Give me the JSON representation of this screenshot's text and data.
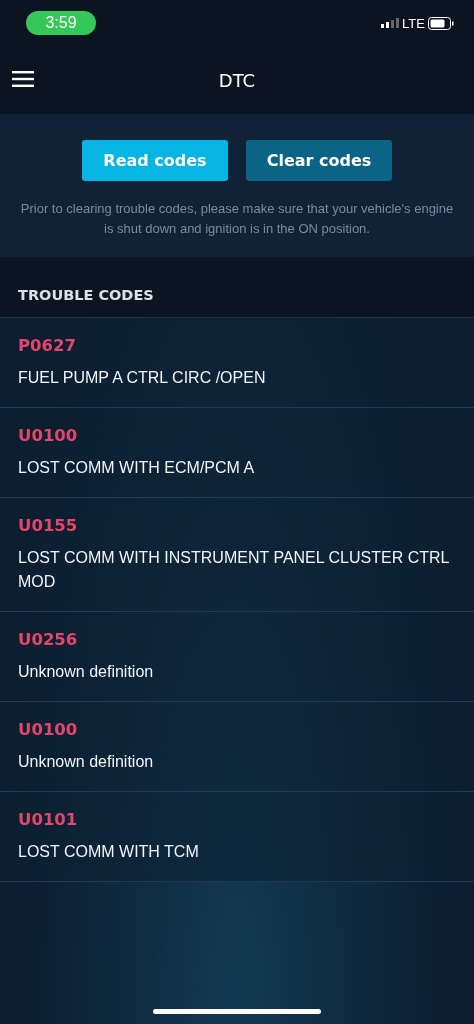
{
  "status_bar": {
    "time": "3:59",
    "network": "LTE"
  },
  "header": {
    "title": "DTC"
  },
  "actions": {
    "buttons": [
      {
        "label": "Read codes",
        "kind": "primary"
      },
      {
        "label": "Clear codes",
        "kind": "secondary"
      }
    ],
    "note": "Prior to clearing trouble codes, please make sure that your vehicle's engine is shut down and ignition is in the ON position."
  },
  "trouble_codes": {
    "heading": "TROUBLE CODES",
    "items": [
      {
        "code": "P0627",
        "description": "FUEL PUMP A CTRL CIRC /OPEN"
      },
      {
        "code": "U0100",
        "description": "LOST COMM WITH ECM/PCM A"
      },
      {
        "code": "U0155",
        "description": "LOST COMM WITH INSTRUMENT PANEL CLUSTER CTRL MOD"
      },
      {
        "code": "U0256",
        "description": "Unknown definition"
      },
      {
        "code": "U0100",
        "description": "Unknown definition"
      },
      {
        "code": "U0101",
        "description": "LOST COMM WITH TCM"
      }
    ]
  }
}
